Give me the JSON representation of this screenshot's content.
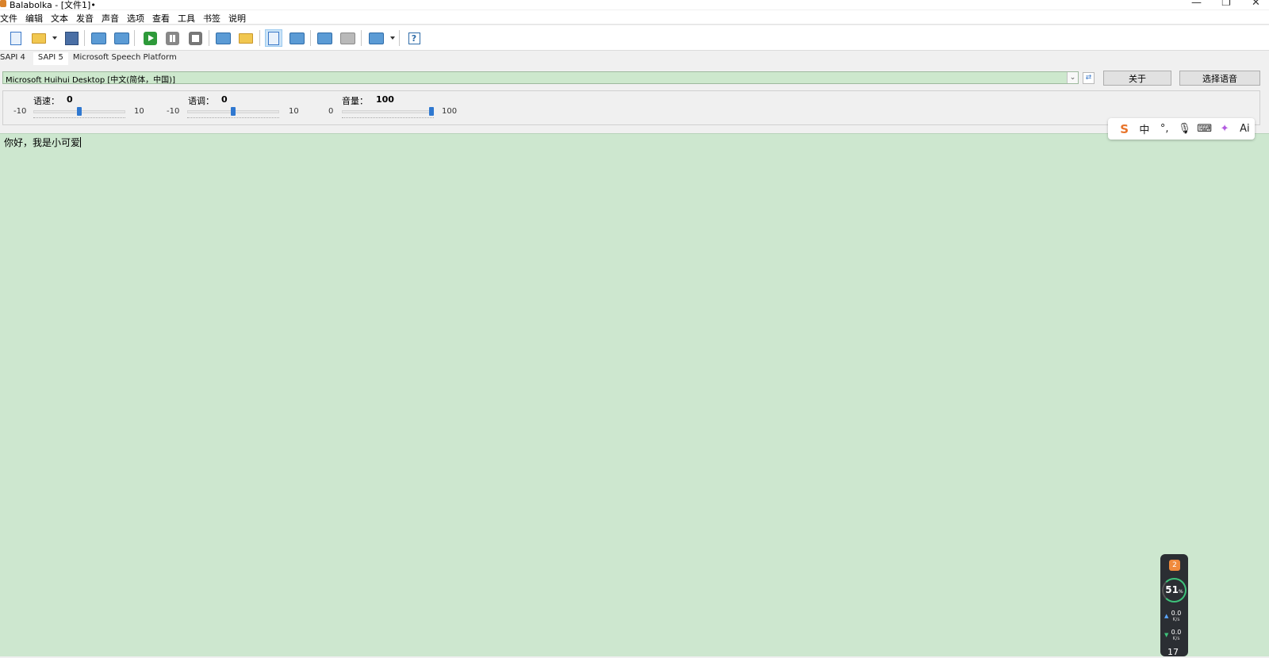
{
  "window": {
    "title": "Balabolka - [文件1]•",
    "controls": {
      "minimize": "—",
      "maximize": "❐",
      "close": "✕"
    }
  },
  "menu": [
    "文件",
    "编辑",
    "文本",
    "发音",
    "声音",
    "选项",
    "查看",
    "工具",
    "书签",
    "说明"
  ],
  "toolbar": {
    "buttons": [
      {
        "name": "new-document",
        "icon": "new-document-icon"
      },
      {
        "name": "open-file",
        "icon": "open-folder-icon"
      },
      {
        "name": "save-file",
        "icon": "save-icon"
      },
      {
        "name": "print",
        "icon": "print-icon"
      },
      {
        "name": "print-preview",
        "icon": "print-preview-icon"
      },
      {
        "name": "play",
        "icon": "play-icon"
      },
      {
        "name": "pause",
        "icon": "pause-icon"
      },
      {
        "name": "stop",
        "icon": "stop-icon"
      },
      {
        "name": "read-clipboard",
        "icon": "read-clipboard-icon"
      },
      {
        "name": "read-file",
        "icon": "read-file-icon"
      },
      {
        "name": "edit-text",
        "icon": "edit-text-icon",
        "active": true
      },
      {
        "name": "spell-check",
        "icon": "spell-check-icon"
      },
      {
        "name": "add-bookmark",
        "icon": "add-bookmark-icon"
      },
      {
        "name": "remove-bookmark",
        "icon": "remove-bookmark-icon"
      },
      {
        "name": "bookmarks-menu",
        "icon": "bookmarks-icon"
      },
      {
        "name": "help",
        "icon": "help-icon",
        "glyph": "?"
      }
    ]
  },
  "tabs": [
    {
      "label": "SAPI 4",
      "selected": false
    },
    {
      "label": "SAPI 5",
      "selected": true
    },
    {
      "label": "Microsoft Speech Platform",
      "selected": false
    }
  ],
  "voice": {
    "selected": "Microsoft Huihui Desktop [中文(简体，中国)]",
    "about_label": "关于",
    "choose_label": "选择语音"
  },
  "sliders": {
    "rate": {
      "label": "语速：",
      "value": "0",
      "min": "-10",
      "max": "10",
      "level": 0.5
    },
    "pitch": {
      "label": "语调：",
      "value": "0",
      "min": "-10",
      "max": "10",
      "level": 0.5
    },
    "volume": {
      "label": "音量：",
      "value": "100",
      "min": "0",
      "max": "100",
      "level": 1.0
    }
  },
  "editor": {
    "text": "你好，我是小可爱"
  },
  "ime": {
    "logo": "S",
    "mode": "中",
    "punct": "°,",
    "voice": "mic-icon",
    "keyboard": "keyboard-icon",
    "skin": "magic-icon",
    "ai": "Ai"
  },
  "perf_widget": {
    "badge": "2",
    "cpu_percent": "51",
    "cpu_unit": "%",
    "upload": "0.0",
    "upload_unit": "K/s",
    "download": "0.0",
    "download_unit": "K/s",
    "more": "17"
  },
  "colors": {
    "editor_bg": "#cde7cf",
    "accent": "#2f78d0"
  }
}
